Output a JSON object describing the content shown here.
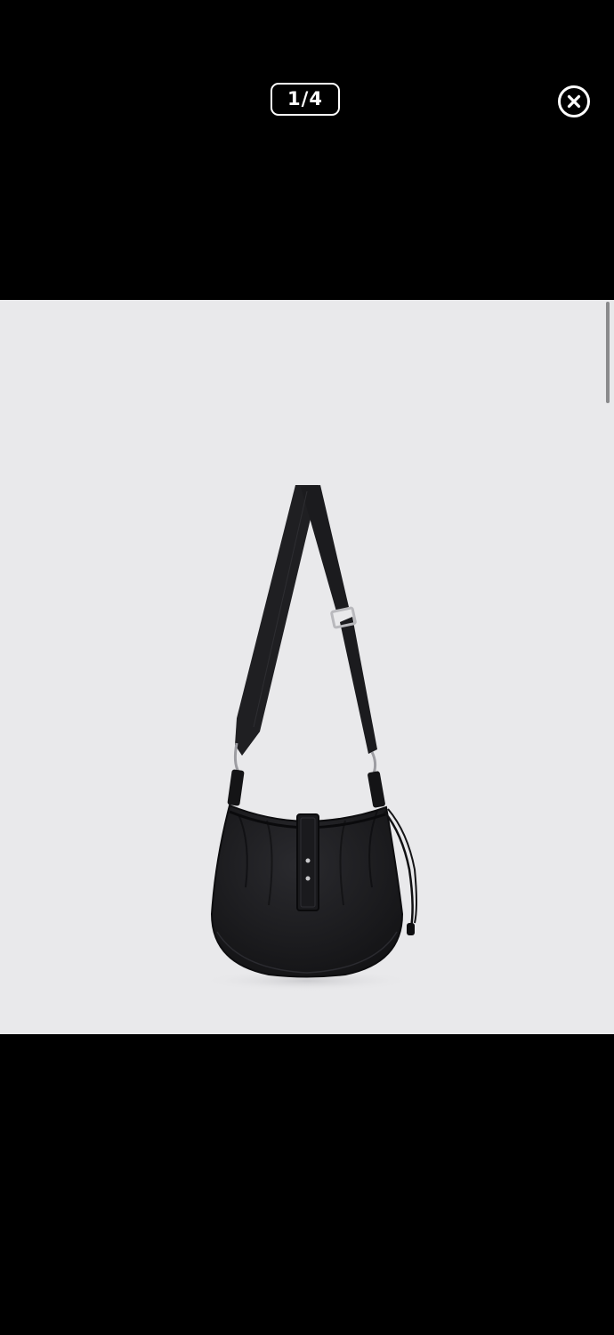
{
  "viewer": {
    "counter_text": "1/4",
    "current_index": 1,
    "total_images": 4,
    "close_icon": "close-circle-icon",
    "background_color": "#000000",
    "photo_background_color": "#e9e9eb",
    "product_color": "#1c1c1f"
  }
}
